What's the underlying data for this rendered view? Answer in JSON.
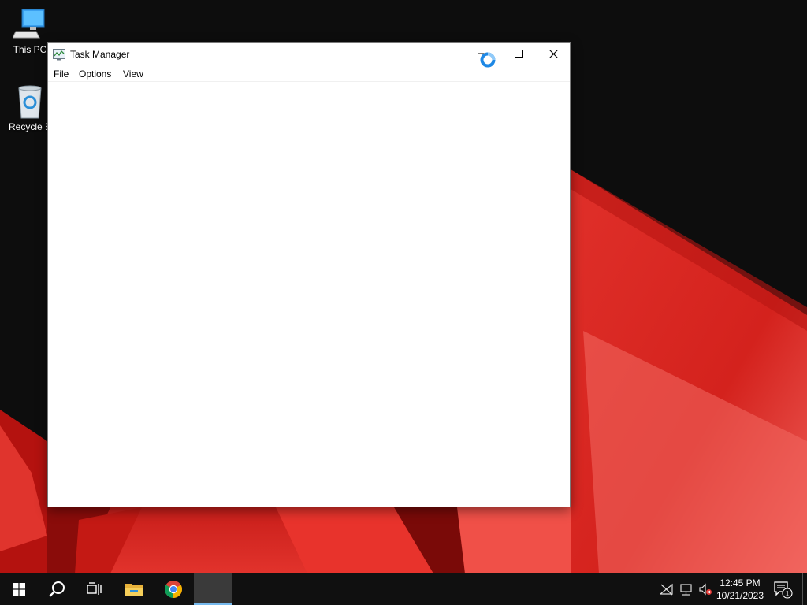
{
  "desktop": {
    "icons": [
      {
        "label": "This PC",
        "icon": "computer-icon"
      },
      {
        "label": "Recycle B",
        "icon": "recycle-bin-icon"
      }
    ]
  },
  "window": {
    "title": "Task Manager",
    "app_icon": "task-manager-icon",
    "menu": [
      "File",
      "Options",
      "View"
    ],
    "state": "loading"
  },
  "taskbar": {
    "apps": [
      "start-icon",
      "search-icon",
      "task-view-icon",
      "file-explorer-icon",
      "chrome-icon",
      "task-manager-icon"
    ],
    "clock": {
      "time": "12:45 PM",
      "date": "10/21/2023"
    },
    "tray": [
      "network-disconnected-icon",
      "network-icon",
      "volume-muted-icon",
      "notifications-icon"
    ],
    "notification_count": "1",
    "accent_color": "#76b9ed"
  },
  "colors": {
    "wallpaper_red": "#e8302a",
    "wallpaper_dark": "#0d0d0d",
    "busy_cursor": "#1e88e5"
  }
}
